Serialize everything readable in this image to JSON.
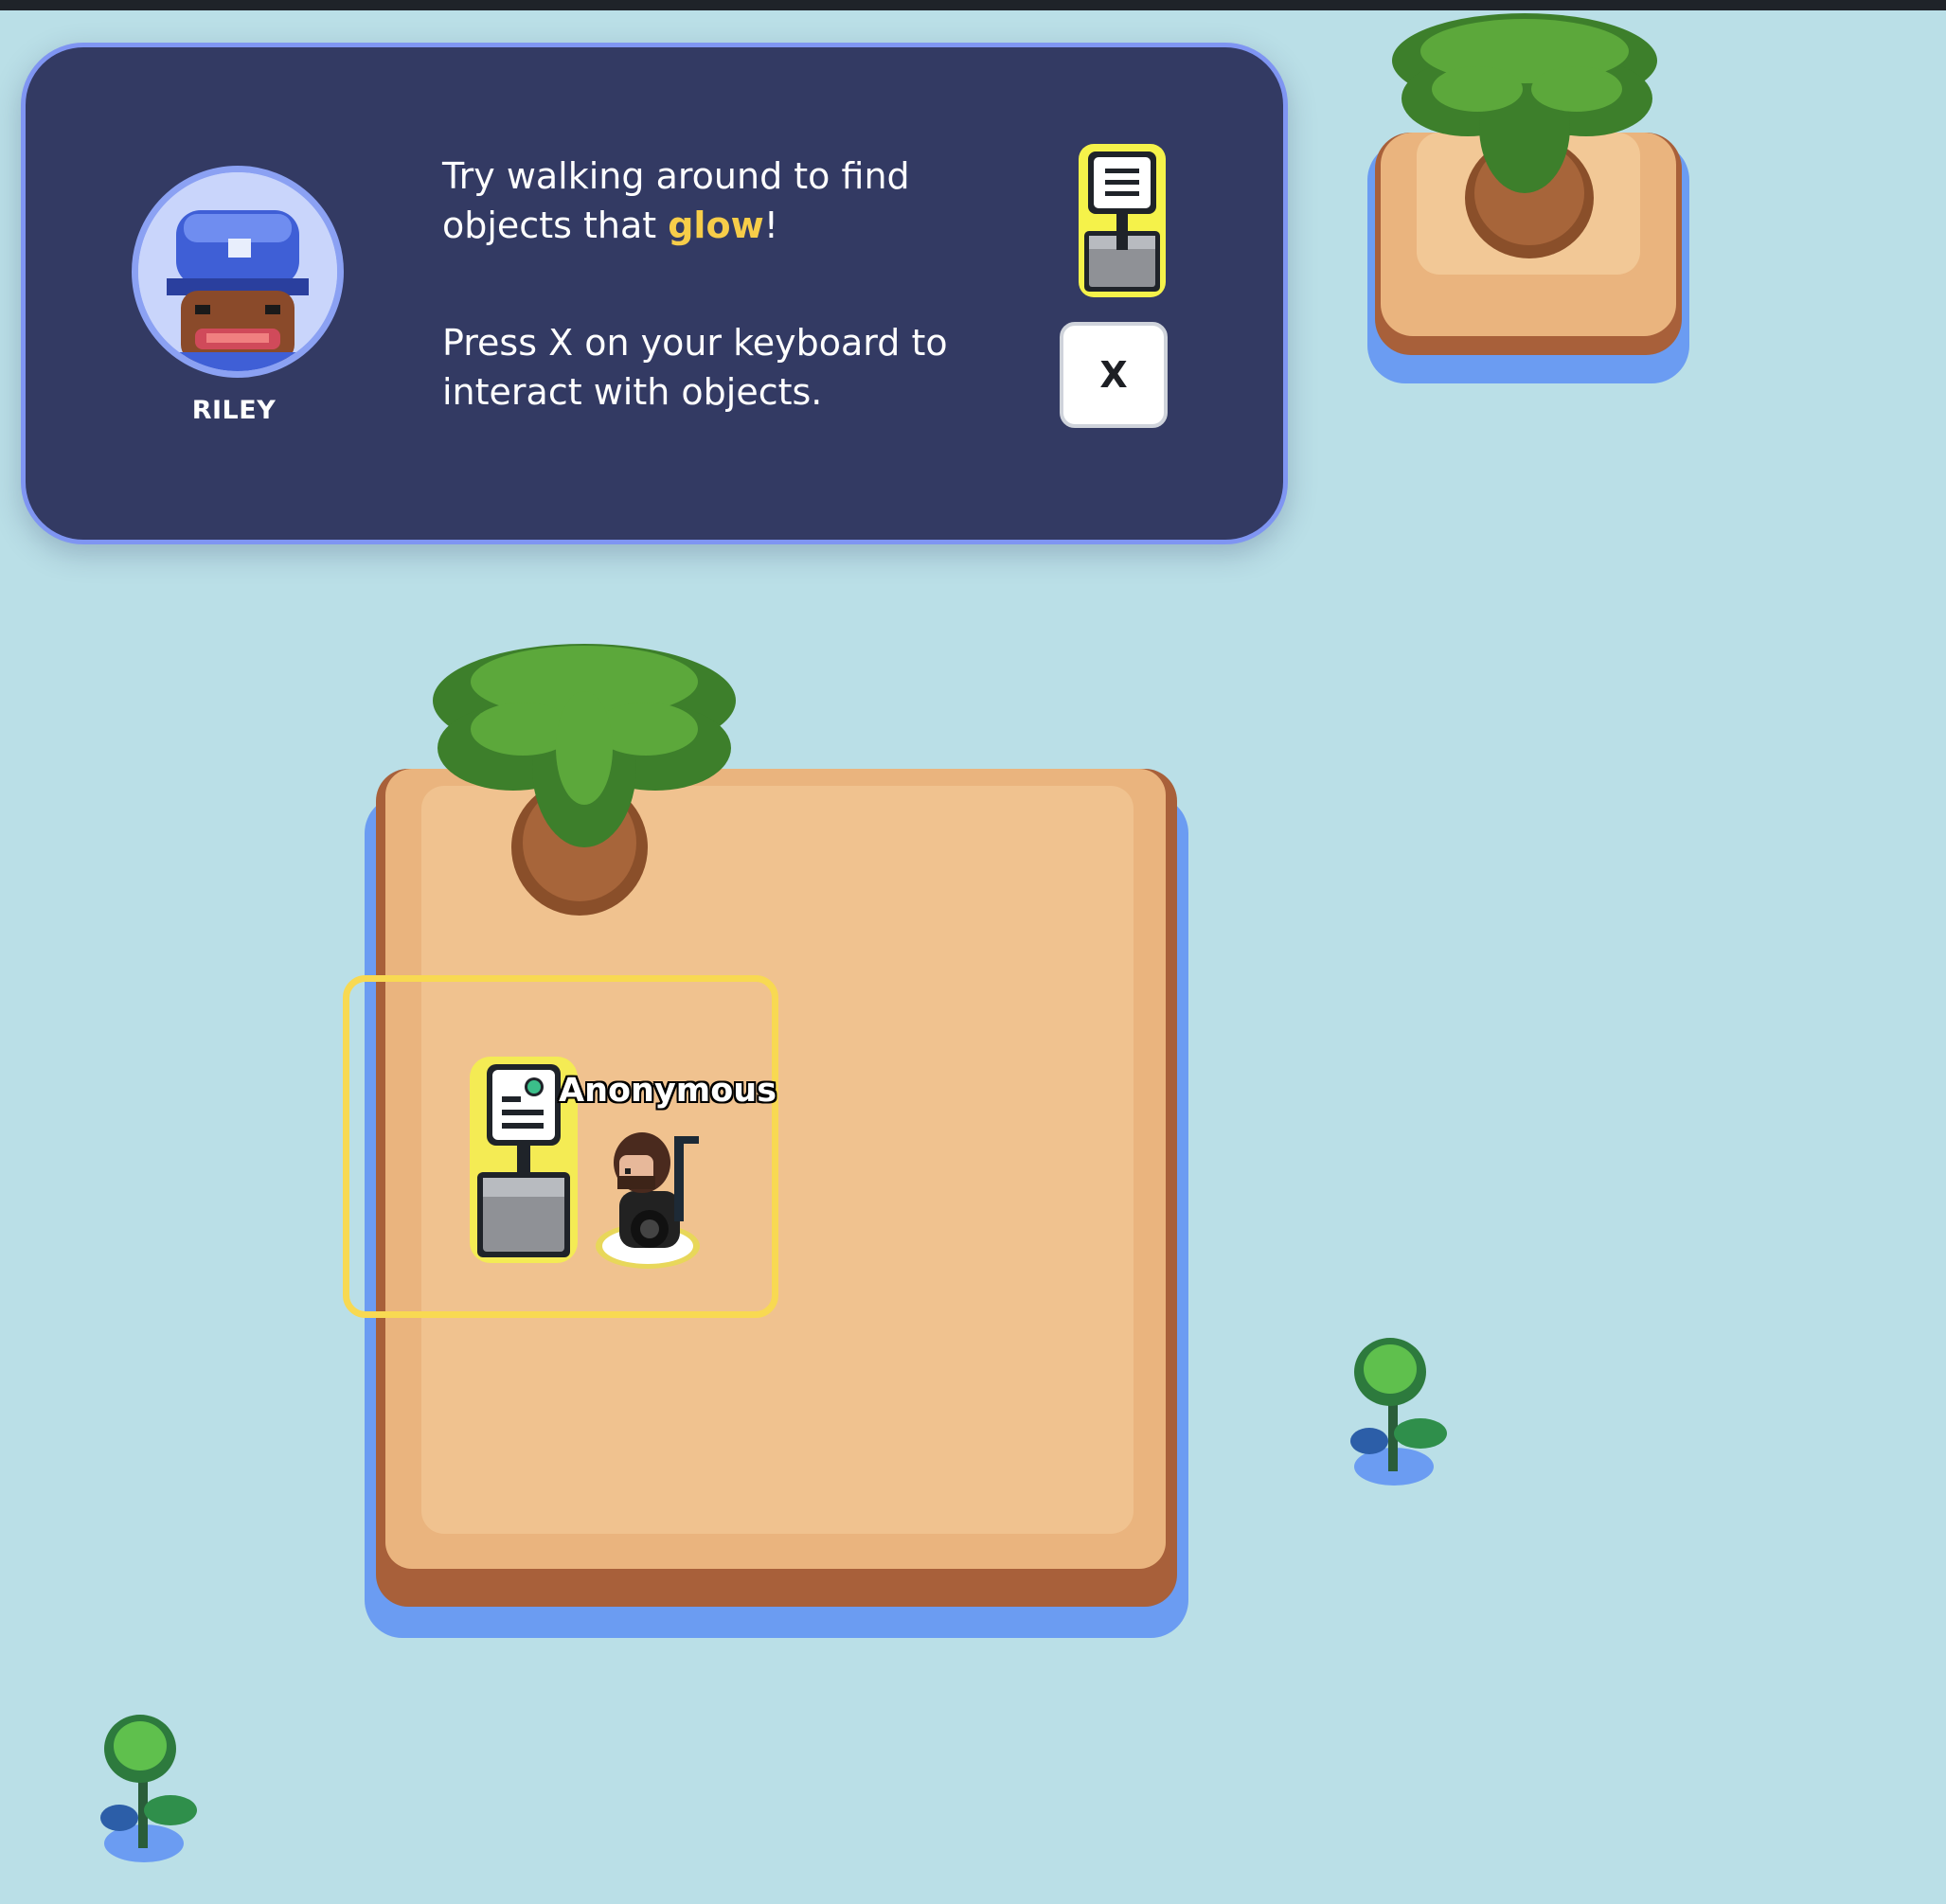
{
  "tutorial": {
    "character_name": "RILEY",
    "line1_before": "Try walking around to find objects that ",
    "line1_highlight": "glow",
    "line1_after": "!",
    "line2": "Press X on your keyboard to interact with objects.",
    "key_label": "X",
    "icon": "signpost-icon"
  },
  "player": {
    "name": "Anonymous"
  },
  "colors": {
    "water": "#badfe7",
    "panel": "#333a63",
    "panel_border": "#7f95f2",
    "highlight": "#f7cd49",
    "sand": "#eab47e",
    "sand_edge": "#a8603a",
    "focus_border": "#f8d952"
  }
}
